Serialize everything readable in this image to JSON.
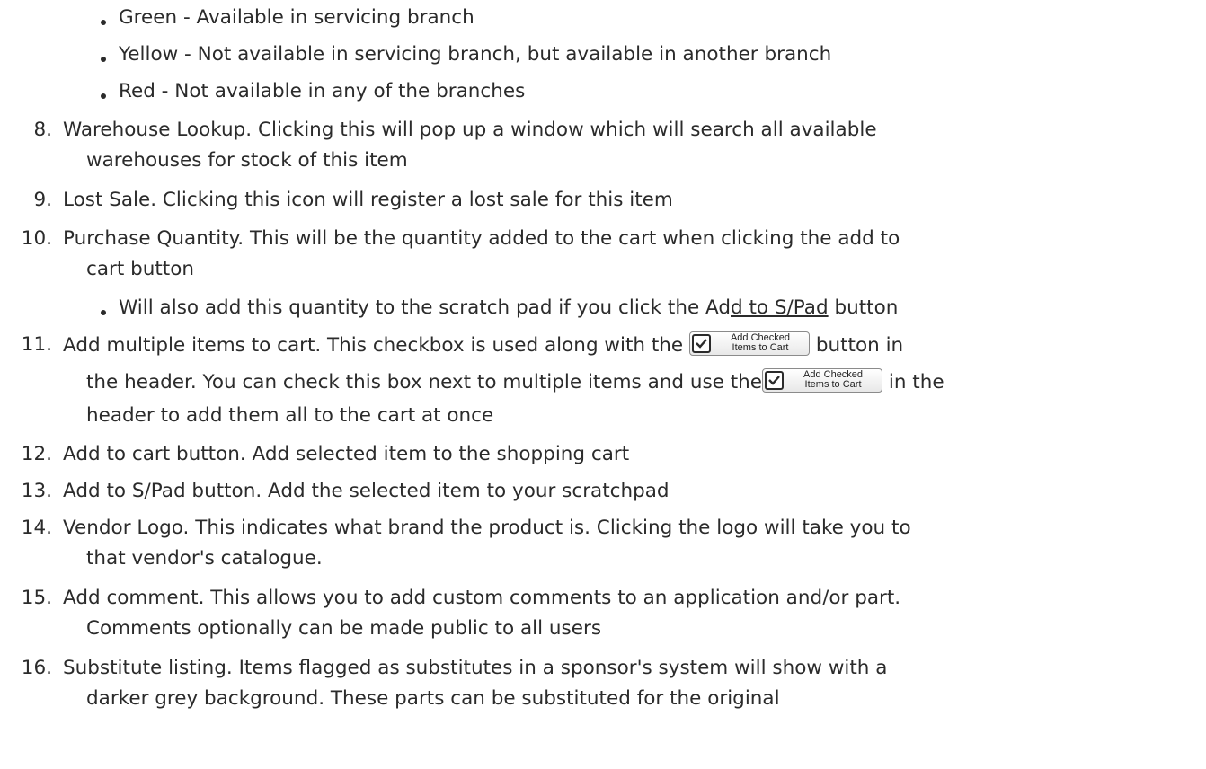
{
  "availability_bullets": [
    "Green - Available in servicing branch",
    "Yellow - Not available in servicing branch, but available in another branch",
    "Red - Not available in any of the branches"
  ],
  "items": [
    {
      "number": "8.",
      "lines": [
        "Warehouse Lookup. Clicking this will pop up a window which will search all available",
        "warehouses for stock of this item"
      ]
    },
    {
      "number": "9.",
      "lines": [
        "Lost Sale. Clicking this icon will register a lost sale for this item"
      ]
    },
    {
      "number": "10.",
      "lines": [
        "Purchase Quantity. This will be the quantity added to the cart when clicking the add to",
        "cart button"
      ]
    },
    {
      "number": "11.",
      "line1_before": "Add multiple items to cart. This checkbox is used along with the ",
      "line1_after": " button in",
      "line2_before": "the header. You can check this box next to multiple items and use the",
      "line2_after": " in the",
      "line3": "header to add them all to the cart at once"
    },
    {
      "number": "12.",
      "lines": [
        "Add to cart button. Add selected item to the shopping cart"
      ]
    },
    {
      "number": "13.",
      "lines": [
        "Add to S/Pad button. Add the selected item to your scratchpad"
      ]
    },
    {
      "number": "14.",
      "lines": [
        "Vendor Logo. This indicates what brand the product is. Clicking the logo will take you to",
        "that vendor's catalogue."
      ]
    },
    {
      "number": "15.",
      "lines": [
        "Add comment. This allows you to add custom comments to an application and/or part.",
        "Comments optionally can be made public to all users"
      ]
    },
    {
      "number": "16.",
      "lines": [
        "Substitute listing. Items flagged as substitutes in a sponsor's system will show with a",
        "darker grey background. These parts can be substituted for the original"
      ]
    }
  ],
  "purchase_sub_bullet_before": "Will also add this quantity to the scratch pad if you click the Ad",
  "purchase_sub_bullet_underlined": "d to S/Pad",
  "purchase_sub_bullet_after": " button",
  "add_checked_button": {
    "label_line1": "Add Checked",
    "label_line2": "Items to Cart",
    "icon": "checkbox-checked-icon"
  }
}
